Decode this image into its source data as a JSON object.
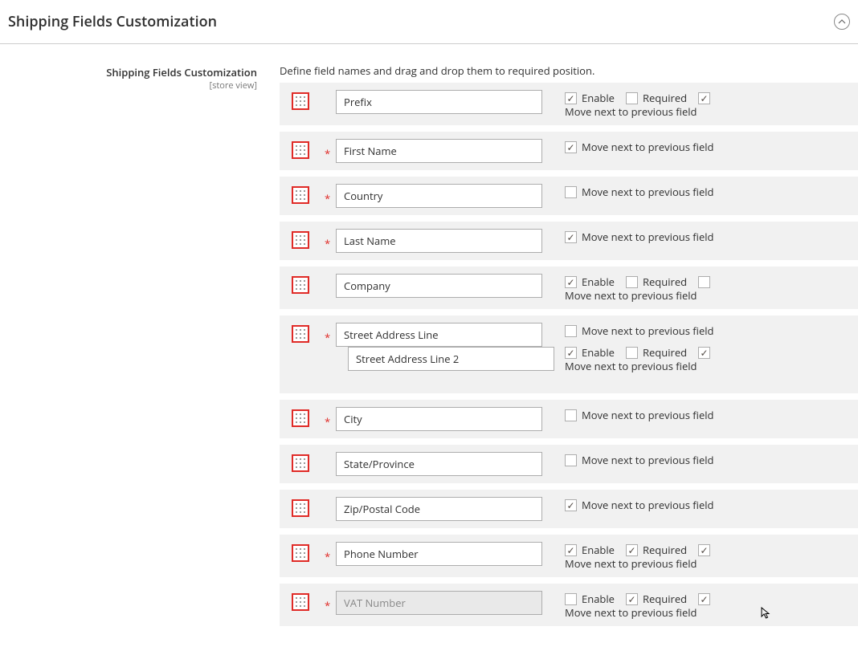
{
  "header": {
    "title": "Shipping Fields Customization"
  },
  "sidebar": {
    "label": "Shipping Fields Customization",
    "scope": "[store view]"
  },
  "description": "Define field names and drag and drop them to required position.",
  "labels": {
    "enable": "Enable",
    "required": "Required",
    "moveNext": "Move next to previous field"
  },
  "rows": [
    {
      "name": "Prefix",
      "required": false,
      "showEnable": true,
      "enable": true,
      "showReq": true,
      "req": false,
      "showTrail": true,
      "trail": true,
      "move": null,
      "disabled": false
    },
    {
      "name": "First Name",
      "required": true,
      "showEnable": false,
      "enable": false,
      "showReq": false,
      "req": false,
      "showTrail": false,
      "trail": false,
      "move": true,
      "disabled": false
    },
    {
      "name": "Country",
      "required": true,
      "showEnable": false,
      "enable": false,
      "showReq": false,
      "req": false,
      "showTrail": false,
      "trail": false,
      "move": false,
      "disabled": false
    },
    {
      "name": "Last Name",
      "required": true,
      "showEnable": false,
      "enable": false,
      "showReq": false,
      "req": false,
      "showTrail": false,
      "trail": false,
      "move": true,
      "disabled": false
    },
    {
      "name": "Company",
      "required": false,
      "showEnable": true,
      "enable": true,
      "showReq": true,
      "req": false,
      "showTrail": true,
      "trail": false,
      "move": null,
      "disabled": false
    },
    {
      "name": "Street Address Line",
      "required": true,
      "showEnable": false,
      "enable": false,
      "showReq": false,
      "req": false,
      "showTrail": false,
      "trail": false,
      "move": false,
      "disabled": false,
      "sub": {
        "name": "Street Address Line 2",
        "showEnable": true,
        "enable": true,
        "showReq": true,
        "req": false,
        "showTrail": true,
        "trail": true,
        "move": null
      }
    },
    {
      "name": "City",
      "required": true,
      "showEnable": false,
      "enable": false,
      "showReq": false,
      "req": false,
      "showTrail": false,
      "trail": false,
      "move": false,
      "disabled": false
    },
    {
      "name": "State/Province",
      "required": false,
      "showEnable": false,
      "enable": false,
      "showReq": false,
      "req": false,
      "showTrail": false,
      "trail": false,
      "move": false,
      "disabled": false
    },
    {
      "name": "Zip/Postal Code",
      "required": false,
      "showEnable": false,
      "enable": false,
      "showReq": false,
      "req": false,
      "showTrail": false,
      "trail": false,
      "move": true,
      "disabled": false
    },
    {
      "name": "Phone Number",
      "required": true,
      "showEnable": true,
      "enable": true,
      "showReq": true,
      "req": true,
      "showTrail": true,
      "trail": true,
      "move": null,
      "disabled": false
    },
    {
      "name": "VAT Number",
      "required": true,
      "showEnable": true,
      "enable": false,
      "showReq": true,
      "req": true,
      "showTrail": true,
      "trail": true,
      "move": null,
      "disabled": true
    }
  ]
}
